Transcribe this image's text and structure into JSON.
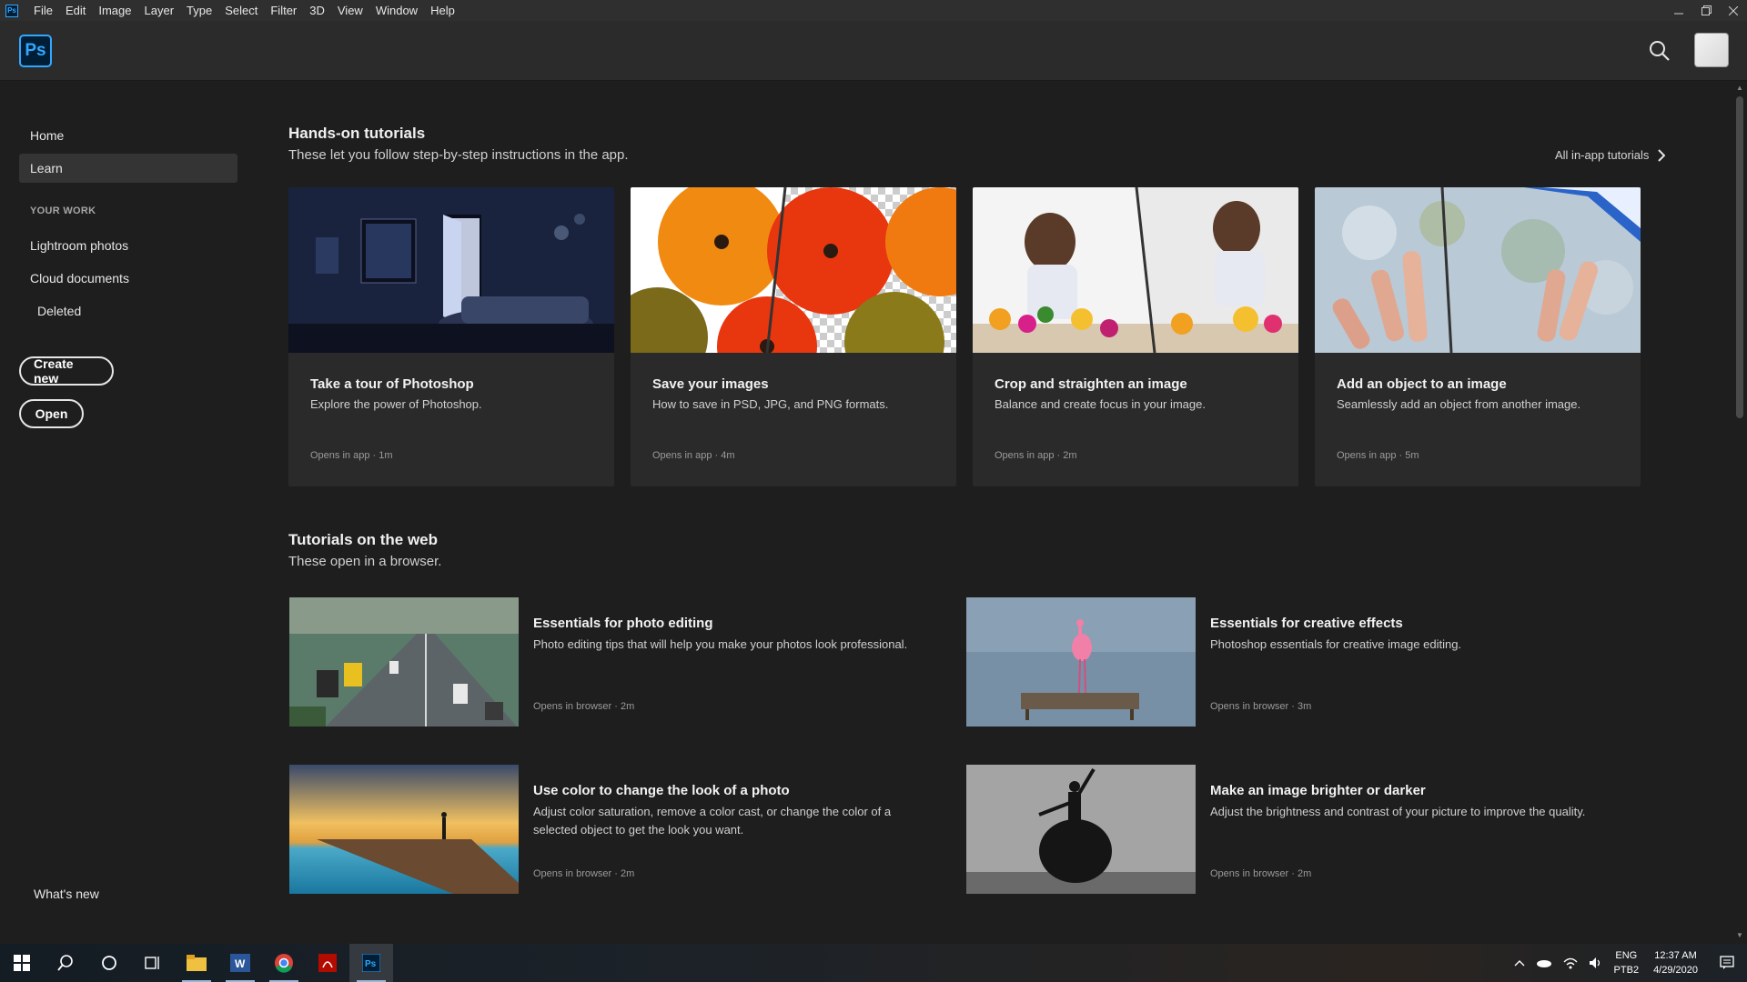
{
  "menubar": {
    "app_icon": "Ps",
    "items": [
      "File",
      "Edit",
      "Image",
      "Layer",
      "Type",
      "Select",
      "Filter",
      "3D",
      "View",
      "Window",
      "Help"
    ],
    "controls": [
      "minimize-icon",
      "restore-icon",
      "close-icon"
    ]
  },
  "header": {
    "logo": "Ps",
    "search_icon": "search-icon",
    "avatar": "user-avatar"
  },
  "sidebar": {
    "home": "Home",
    "learn": "Learn",
    "your_work_heading": "YOUR WORK",
    "lightroom": "Lightroom photos",
    "cloud": "Cloud documents",
    "deleted": "Deleted",
    "create_new": "Create new",
    "open": "Open",
    "whats_new": "What's new"
  },
  "hands_on": {
    "title": "Hands-on tutorials",
    "subtitle": "These let you follow step-by-step instructions in the app.",
    "all_link": "All in-app tutorials",
    "cards": [
      {
        "title": "Take a tour of Photoshop",
        "desc": "Explore the power of Photoshop.",
        "opens": "Opens in app",
        "duration": "1m"
      },
      {
        "title": "Save your images",
        "desc": "How to save in PSD, JPG, and PNG formats.",
        "opens": "Opens in app",
        "duration": "4m"
      },
      {
        "title": "Crop and straighten an image",
        "desc": "Balance and create focus in your image.",
        "opens": "Opens in app",
        "duration": "2m"
      },
      {
        "title": "Add an object to an image",
        "desc": "Seamlessly add an object from another image.",
        "opens": "Opens in app",
        "duration": "5m"
      }
    ]
  },
  "web": {
    "title": "Tutorials on the web",
    "subtitle": "These open in a browser.",
    "items": [
      {
        "title": "Essentials for photo editing",
        "desc": "Photo editing tips that will help you make your photos look professional.",
        "opens": "Opens in browser",
        "duration": "2m"
      },
      {
        "title": "Essentials for creative effects",
        "desc": "Photoshop essentials for creative image editing.",
        "opens": "Opens in browser",
        "duration": "3m"
      },
      {
        "title": "Use color to change the look of a photo",
        "desc": "Adjust color saturation, remove a color cast, or change the color of a selected object to get the look you want.",
        "opens": "Opens in browser",
        "duration": "2m"
      },
      {
        "title": "Make an image brighter or darker",
        "desc": "Adjust the brightness and contrast of your picture to improve the quality.",
        "opens": "Opens in browser",
        "duration": "2m"
      }
    ]
  },
  "taskbar": {
    "apps": [
      "start-icon",
      "search-icon",
      "cortana-icon",
      "task-view-icon",
      "file-explorer-icon",
      "word-icon",
      "chrome-icon",
      "acrobat-icon",
      "photoshop-icon"
    ],
    "lang_line1": "ENG",
    "lang_line2": "PTB2",
    "time": "12:37 AM",
    "date": "4/29/2020"
  },
  "colors": {
    "ps_blue": "#31a8ff",
    "ps_dark": "#001e36",
    "background": "#1e1e1e",
    "card": "#2a2a2a"
  }
}
